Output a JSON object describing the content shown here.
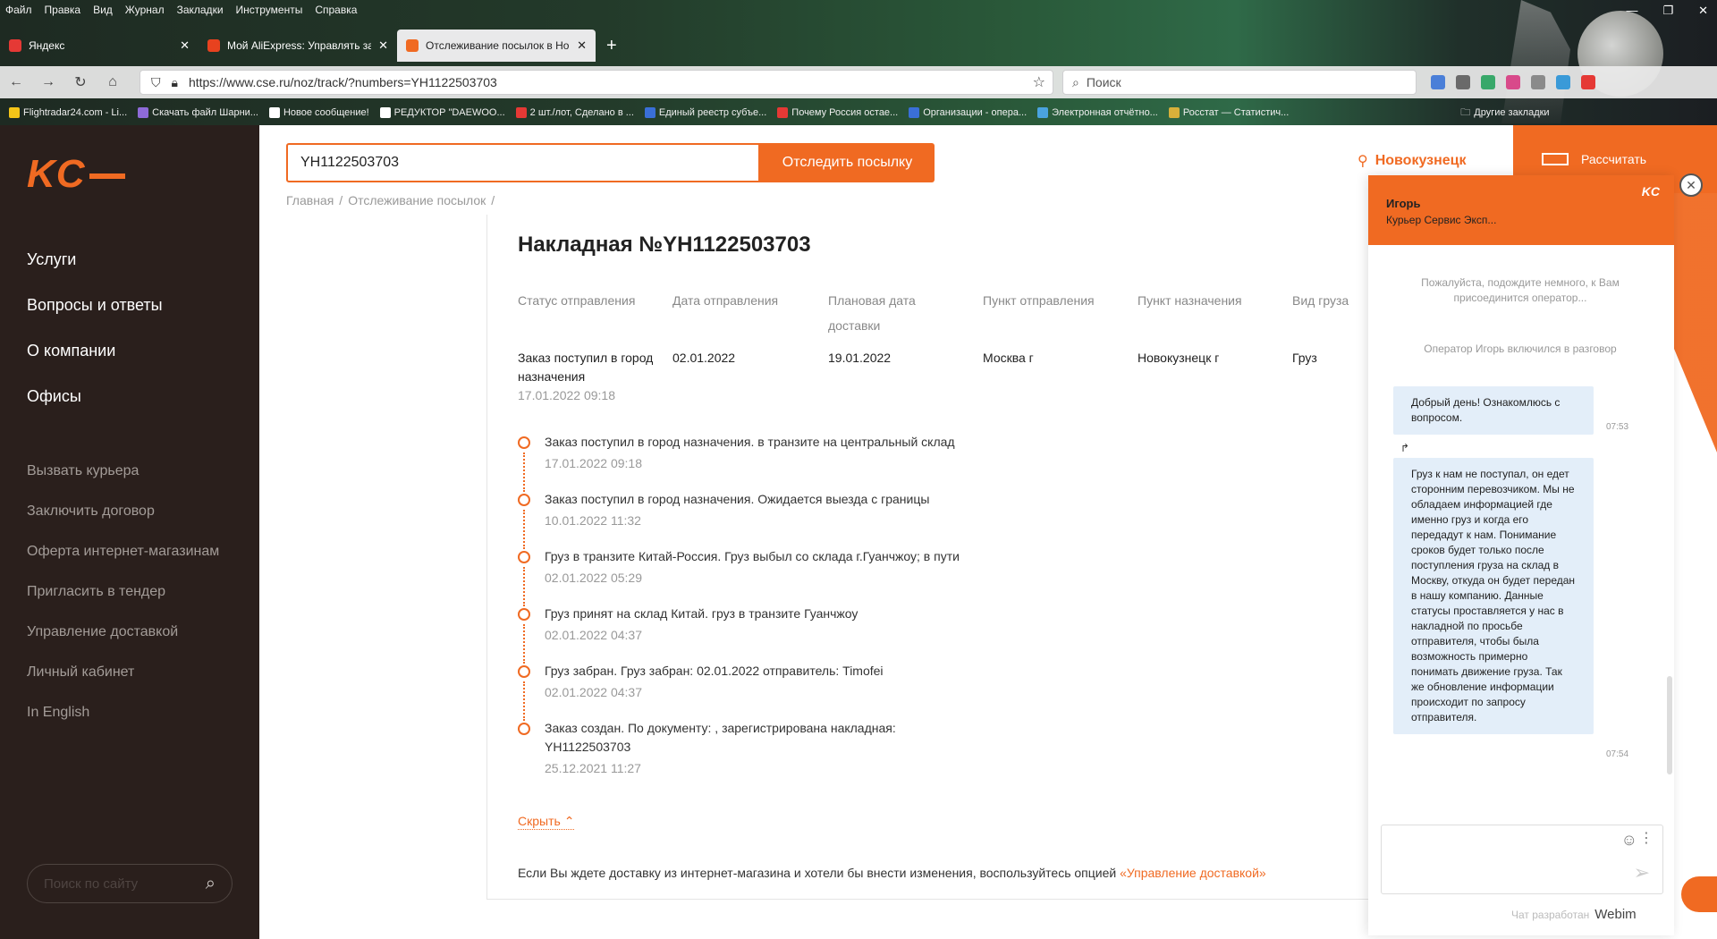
{
  "browser": {
    "menu": [
      "Файл",
      "Правка",
      "Вид",
      "Журнал",
      "Закладки",
      "Инструменты",
      "Справка"
    ],
    "tabs": [
      {
        "title": "Яндекс",
        "color": "#e53935"
      },
      {
        "title": "Мой AliExpress: Управлять зак",
        "color": "#e8421f"
      },
      {
        "title": "Отслеживание посылок в Но",
        "color": "#f06a22"
      }
    ],
    "url": "https://www.cse.ru/noz/track/?numbers=YH1122503703",
    "search_placeholder": "Поиск",
    "bookmarks": [
      {
        "label": "Flightradar24.com - Li...",
        "color": "#f5c518"
      },
      {
        "label": "Скачать файл Шарни...",
        "color": "#8e6bd8"
      },
      {
        "label": "Новое сообщение!",
        "color": "#ffffff"
      },
      {
        "label": "РЕДУКТОР \"DAEWOO...",
        "color": "#ffffff"
      },
      {
        "label": "2 шт./лот, Сделано в ...",
        "color": "#e53935"
      },
      {
        "label": "Единый реестр субъе...",
        "color": "#3a6fd8"
      },
      {
        "label": "Почему Россия остае...",
        "color": "#e53935"
      },
      {
        "label": "Организации - опера...",
        "color": "#3a6fd8"
      },
      {
        "label": "Электронная отчётно...",
        "color": "#4aa3df"
      },
      {
        "label": "Росстат — Статистич...",
        "color": "#d8b03a"
      }
    ],
    "other_bookmarks": "Другие закладки"
  },
  "sidebar": {
    "logo": "KC",
    "main_nav": [
      "Услуги",
      "Вопросы и ответы",
      "О компании",
      "Офисы"
    ],
    "sub_nav": [
      "Вызвать курьера",
      "Заключить договор",
      "Оферта интернет-магазинам",
      "Пригласить в тендер",
      "Управление доставкой",
      "Личный кабинет",
      "In English"
    ],
    "search_placeholder": "Поиск по сайту"
  },
  "header": {
    "track_value": "YH1122503703",
    "track_button": "Отследить посылку",
    "city": "Новокузнецк",
    "calc_label": "Рассчитать",
    "breadcrumb": [
      "Главная",
      "/",
      "Отслеживание посылок",
      "/"
    ]
  },
  "waybill": {
    "title": "Накладная №YH1122503703",
    "columns": [
      {
        "head": "Статус отправления",
        "value": "Заказ поступил в город назначения",
        "sub": "17.01.2022 09:18"
      },
      {
        "head": "Дата отправления",
        "value": "02.01.2022",
        "sub": ""
      },
      {
        "head": "Плановая дата доставки",
        "value": "19.01.2022",
        "sub": ""
      },
      {
        "head": "Пункт отправления",
        "value": "Москва г",
        "sub": ""
      },
      {
        "head": "Пункт назначения",
        "value": "Новокузнецк г",
        "sub": ""
      },
      {
        "head": "Вид груза",
        "value": "Груз",
        "sub": ""
      }
    ],
    "history": [
      {
        "text": "Заказ поступил в город назначения. в транзите на центральный склад",
        "date": "17.01.2022 09:18"
      },
      {
        "text": "Заказ поступил в город назначения. Ожидается выезда с границы",
        "date": "10.01.2022 11:32"
      },
      {
        "text": "Груз в транзите Китай-Россия. Груз выбыл со склада г.Гуанчжоу; в пути",
        "date": "02.01.2022 05:29"
      },
      {
        "text": "Груз принят на склад Китай. груз в транзите Гуанчжоу",
        "date": "02.01.2022 04:37"
      },
      {
        "text": "Груз забран. Груз забран: 02.01.2022 отправитель: Timofei",
        "date": "02.01.2022 04:37"
      },
      {
        "text": "Заказ создан. По документу: , зарегистрирована накладная: YH1122503703",
        "date": "25.12.2021 11:27"
      }
    ],
    "hide_label": "Скрыть",
    "footer_text": "Если Вы ждете доставку из интернет-магазина и хотели бы внести изменения, воспользуйтесь опцией",
    "footer_link": "«Управление доставкой»"
  },
  "chat": {
    "operator_name": "Игорь",
    "operator_org": "Курьер Сервис Эксп...",
    "logo": "KC",
    "system_messages": [
      "Пожалуйста, подождите немного, к Вам присоединится оператор...",
      "Оператор Игорь включился в разговор"
    ],
    "messages": [
      {
        "text": "Добрый день! Ознакомлюсь с вопросом.",
        "time": "07:53"
      },
      {
        "text": "Груз к нам не поступал, он едет сторонним перевозчиком. Мы не обладаем информацией где именно груз и когда его передадут к нам. Понимание сроков будет только после поступления груза на склад в Москву, откуда он будет передан в нашу компанию. Данные статусы проставляется у нас в накладной по просьбе отправителя, чтобы была возможность примерно понимать движение груза. Так же обновление информации происходит по запросу отправителя.",
        "time": "07:54"
      }
    ],
    "credit": "Чат разработан",
    "credit_brand": "Webim"
  },
  "colors": {
    "accent": "#f06a22",
    "sidebar_bg": "#2a1f1c",
    "bubble_bg": "#e3eef9"
  }
}
